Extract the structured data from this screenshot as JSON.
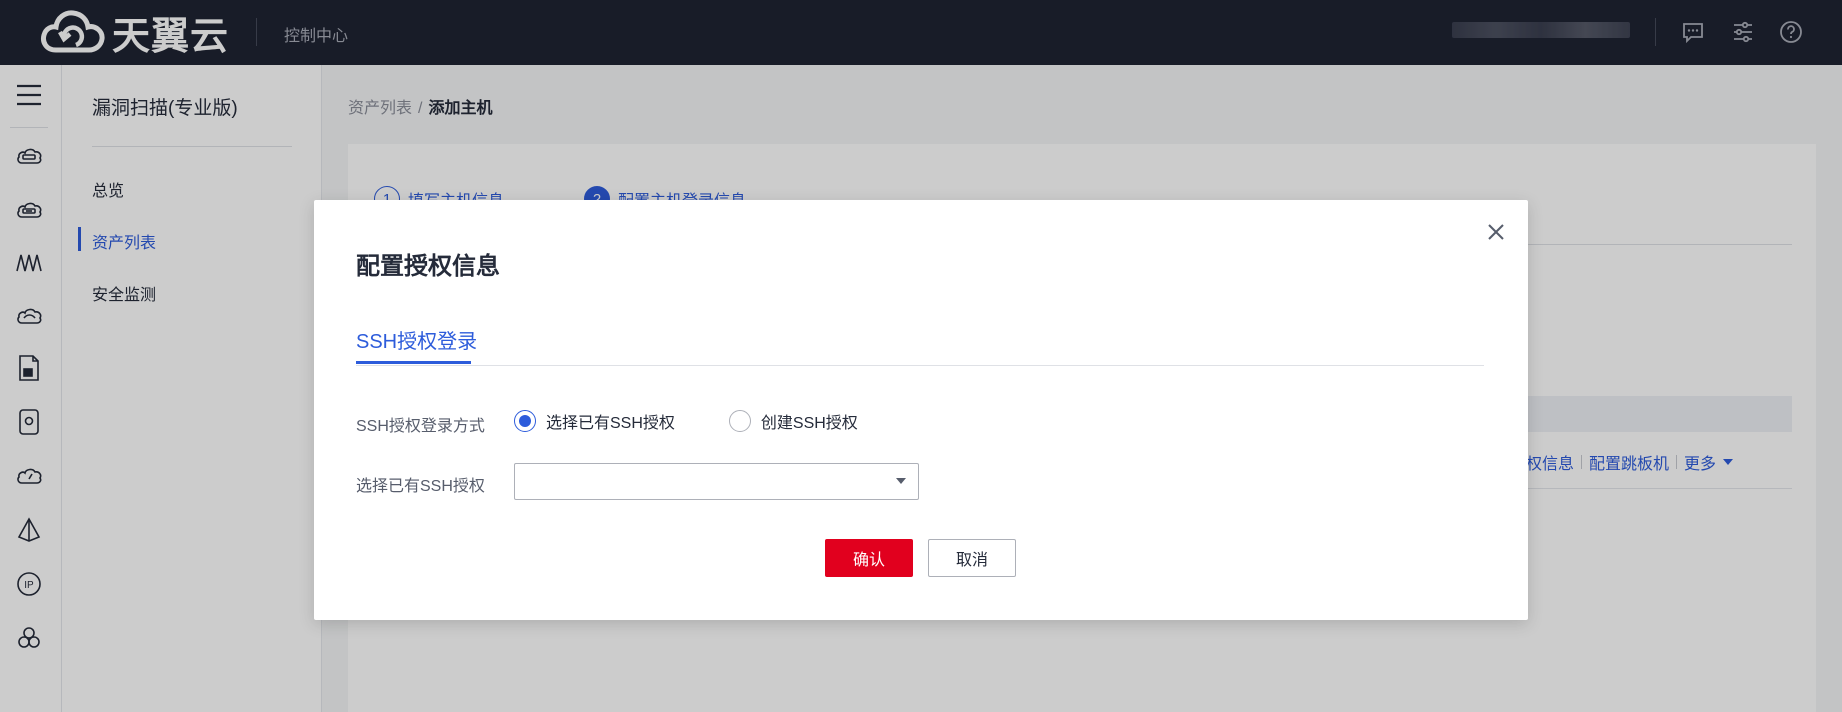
{
  "topbar": {
    "brand": "天翼云",
    "console_link": "控制中心"
  },
  "sidenav": {
    "title": "漏洞扫描(专业版)",
    "items": [
      {
        "label": "总览"
      },
      {
        "label": "资产列表"
      },
      {
        "label": "安全监测"
      }
    ],
    "active_index": 1
  },
  "breadcrumb": {
    "parent": "资产列表",
    "separator": "/",
    "current": "添加主机"
  },
  "steps": [
    {
      "num": "1",
      "label": "填写主机信息"
    },
    {
      "num": "2",
      "label": "配置主机登录信息"
    }
  ],
  "row_actions": {
    "auth": "权信息",
    "jump": "配置跳板机",
    "more": "更多"
  },
  "dialog": {
    "title": "配置授权信息",
    "tab": "SSH授权登录",
    "method_label": "SSH授权登录方式",
    "options": [
      {
        "label": "选择已有SSH授权",
        "checked": true
      },
      {
        "label": "创建SSH授权",
        "checked": false
      }
    ],
    "select_label": "选择已有SSH授权",
    "select_value": "",
    "confirm": "确认",
    "cancel": "取消"
  },
  "colors": {
    "primary": "#2d5cdb",
    "danger": "#e1001e",
    "topbar": "#1f2333"
  }
}
